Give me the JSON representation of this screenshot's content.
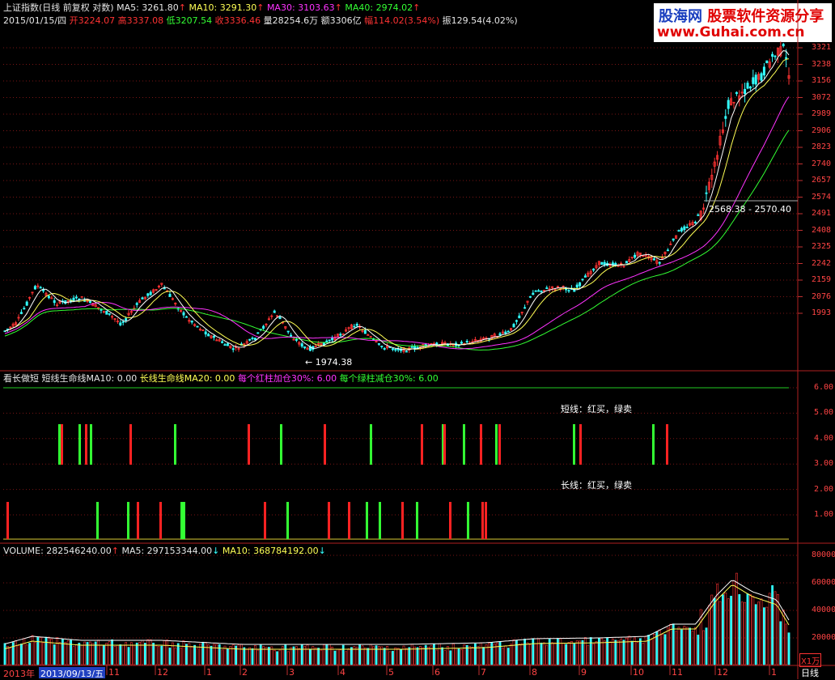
{
  "header": {
    "title": "上证指数(日线 前复权 对数)",
    "ma5": "MA5: 3261.80",
    "ma10": "MA10: 3291.30",
    "ma30": "MA30: 3103.63",
    "ma40": "MA40: 2974.02",
    "up_arrow": "↑",
    "down_arrow": "↓"
  },
  "quote": {
    "date": "2015/01/15/四",
    "open_label": "开",
    "open": "3224.07",
    "high_label": "高",
    "high": "3337.08",
    "low_label": "低",
    "low": "3207.54",
    "close_label": "收",
    "close": "3336.46",
    "volume": "量28254.6万",
    "amount": "额3306亿",
    "change": "幅114.02(3.54%)",
    "amplitude": "振129.54(4.02%)"
  },
  "logo": {
    "line1a": "股海网",
    "line1b": "股票软件资源分享",
    "line2": "www.Guhai.com.cn"
  },
  "price_axis": [
    "3321",
    "3238",
    "3156",
    "3072",
    "2989",
    "2906",
    "2823",
    "2740",
    "2657",
    "2574",
    "2491",
    "2408",
    "2325",
    "2242",
    "2159",
    "2076",
    "1993"
  ],
  "annotations": {
    "low_marker": "1974.38",
    "range_marker": "2568.38 - 2570.40"
  },
  "indicator": {
    "title": "看长做短",
    "short_ma": "短线生命线MA10: 0.00",
    "long_ma": "长线生命线MA20: 0.00",
    "red_add": "每个红柱加仓30%: 6.00",
    "green_cut": "每个绿柱减仓30%: 6.00",
    "note_short": "短线：红买，绿卖",
    "note_long": "长线：红买，绿卖",
    "axis": [
      "6.00",
      "5.00",
      "4.00",
      "3.00",
      "2.00",
      "1.00"
    ]
  },
  "volume": {
    "label": "VOLUME: 282546240.00",
    "ma5": "MA5: 297153344.00",
    "ma10": "MA10: 368784192.00",
    "axis": [
      "80000",
      "60000",
      "40000",
      "20000"
    ],
    "unit": "X1万"
  },
  "time_axis": {
    "year": "2013年",
    "selected_date": "2013/09/13/五",
    "months": [
      "11",
      "12",
      "1",
      "2",
      "3",
      "4",
      "5",
      "6",
      "7",
      "8",
      "9",
      "10",
      "11",
      "12",
      "1"
    ],
    "period": "日线"
  },
  "colors": {
    "background": "#000000",
    "up": "#ff3333",
    "down": "#33ffff",
    "ma5": "#ffffff",
    "ma10": "#ffff55",
    "ma30": "#ff33ff",
    "ma40": "#33ff33"
  }
}
